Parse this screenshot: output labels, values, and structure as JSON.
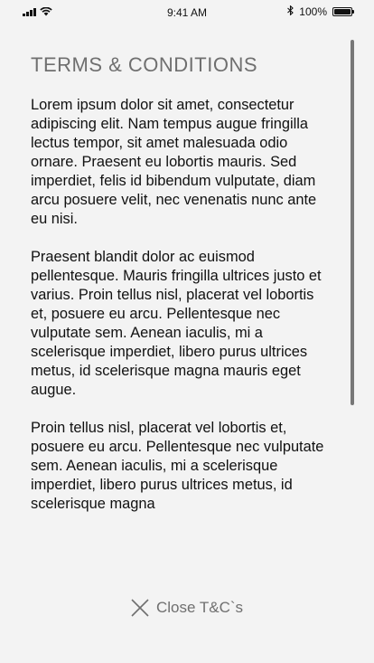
{
  "status_bar": {
    "time": "9:41 AM",
    "battery_percent": "100%",
    "battery_level": 1.0,
    "icons": [
      "signal-icon",
      "wifi-icon",
      "bluetooth-icon",
      "battery-icon"
    ]
  },
  "page": {
    "title": "TERMS & CONDITIONS",
    "paragraphs": [
      "Lorem ipsum dolor sit amet, consectetur adipiscing elit. Nam tempus augue fringilla lectus tempor, sit amet malesuada odio ornare. Praesent eu lobortis mauris. Sed imperdiet, felis id bibendum vulputate, diam arcu posuere velit, nec venenatis nunc ante eu nisi.",
      "Praesent blandit dolor ac euismod pellentesque. Mauris fringilla ultrices justo et varius. Proin tellus nisl, placerat vel lobortis et, posuere eu arcu. Pellentesque nec vulputate sem. Aenean iaculis, mi a scelerisque imperdiet, libero purus ultrices metus, id scelerisque magna mauris eget augue.",
      "Proin tellus nisl, placerat vel lobortis et, posuere eu arcu. Pellentesque nec vulputate sem. Aenean iaculis, mi a scelerisque imperdiet, libero purus ultrices metus, id scelerisque magna"
    ],
    "close_label": "Close T&C`s"
  },
  "colors": {
    "background": "#f3f3f3",
    "title": "#6f6f6f",
    "text": "#111111",
    "scrollbar": "#777777"
  }
}
